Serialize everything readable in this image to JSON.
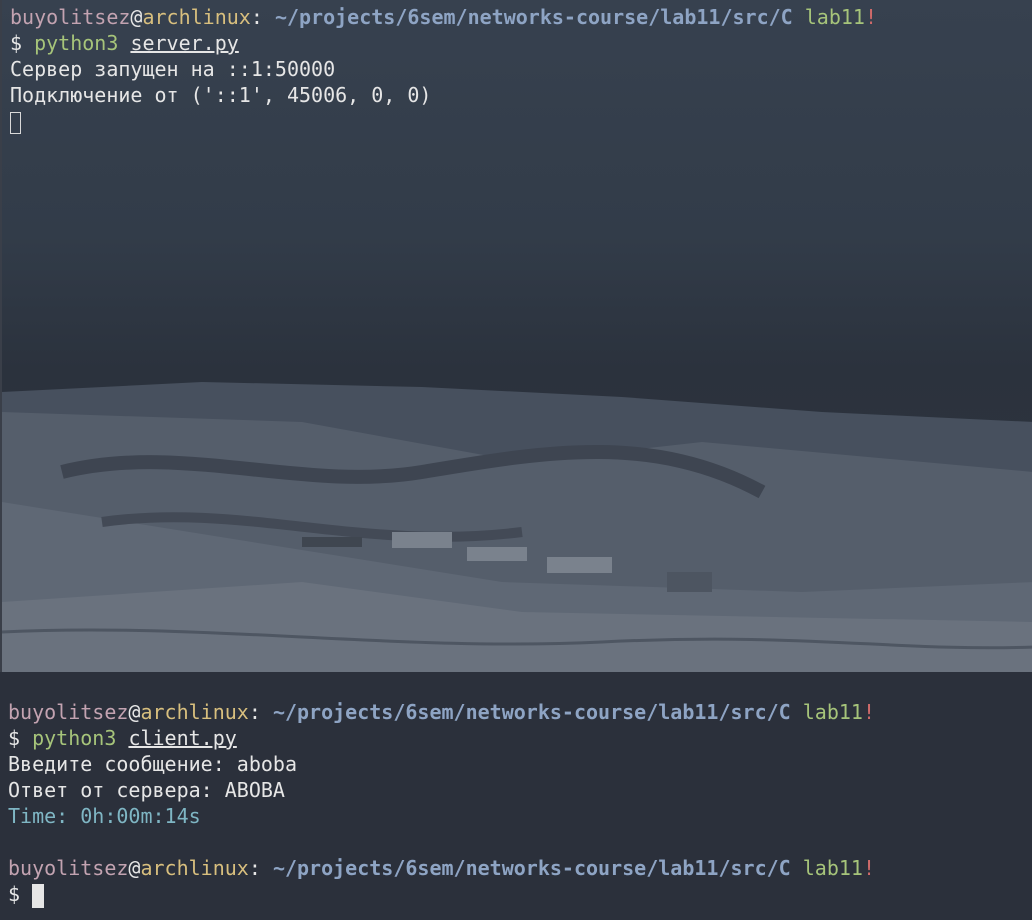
{
  "top_terminal": {
    "prompt": {
      "user": "buyolitsez",
      "at": "@",
      "host": "archlinux",
      "sep": ": ",
      "path": "~/projects/6sem/networks-course/lab11/src/C",
      "branch": "lab11",
      "bang": "!"
    },
    "command_prefix": "$ ",
    "command": "python3",
    "argument": "server.py",
    "output": [
      "Сервер запущен на ::1:50000",
      "Подключение от ('::1', 45006, 0, 0)"
    ]
  },
  "bottom_terminal": {
    "prompt": {
      "user": "buyolitsez",
      "at": "@",
      "host": "archlinux",
      "sep": ": ",
      "path": "~/projects/6sem/networks-course/lab11/src/C",
      "branch": "lab11",
      "bang": "!"
    },
    "command_prefix": "$ ",
    "command": "python3",
    "argument": "client.py",
    "output": [
      "Введите сообщение: aboba",
      "Ответ от сервера: ABOBA"
    ],
    "time_label": "Time: 0h:00m:14s",
    "prompt2": {
      "user": "buyolitsez",
      "at": "@",
      "host": "archlinux",
      "sep": ": ",
      "path": "~/projects/6sem/networks-course/lab11/src/C",
      "branch": "lab11",
      "bang": "!"
    },
    "prompt2_prefix": "$ "
  },
  "colors": {
    "user": "#c3a3b1",
    "host": "#d8bf7e",
    "path": "#8ea4c4",
    "branch": "#a6c47a",
    "bang": "#d06a6a",
    "time": "#7fb6c4",
    "background": "#2b303b"
  }
}
